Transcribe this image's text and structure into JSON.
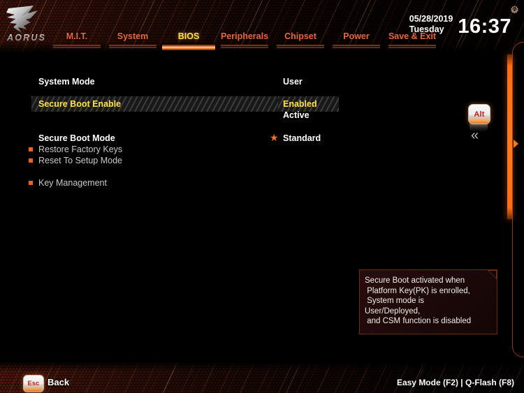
{
  "header": {
    "logo_wordmark": "AORUS",
    "logo_icon": "aorus-eagle-logo",
    "gear_icon": "gear-icon",
    "clock": {
      "date": "05/28/2019",
      "weekday": "Tuesday",
      "time": "16:37"
    },
    "tabs": [
      {
        "label": "M.I.T.",
        "active": false
      },
      {
        "label": "System",
        "active": false
      },
      {
        "label": "BIOS",
        "active": true
      },
      {
        "label": "Peripherals",
        "active": false
      },
      {
        "label": "Chipset",
        "active": false
      },
      {
        "label": "Power",
        "active": false
      },
      {
        "label": "Save & Exit",
        "active": false
      }
    ]
  },
  "main": {
    "rows": [
      {
        "label": "System Mode",
        "value": "User",
        "style": "white",
        "bullet": false,
        "star": false,
        "selected": false
      },
      {
        "label": "Secure Boot Enable",
        "value": "Enabled",
        "style": "yellow",
        "bullet": false,
        "star": false,
        "selected": true
      },
      {
        "label": "",
        "value": "Active",
        "style": "white",
        "bullet": false,
        "star": false,
        "selected": false
      },
      {
        "label": "Secure Boot Mode",
        "value": "Standard",
        "style": "white",
        "bullet": false,
        "star": true,
        "selected": false
      },
      {
        "label": "Restore Factory Keys",
        "value": "",
        "style": "grey",
        "bullet": true,
        "star": false,
        "selected": false
      },
      {
        "label": "Reset To Setup Mode",
        "value": "",
        "style": "grey",
        "bullet": true,
        "star": false,
        "selected": false
      },
      {
        "label": "Key Management",
        "value": "",
        "style": "grey",
        "bullet": true,
        "star": false,
        "selected": false
      }
    ]
  },
  "side_panel": {
    "alt_key_label": "Alt",
    "collapse_icon": "double-chevron-left-icon",
    "collapse_glyph": "«",
    "rail_arrow_icon": "expand-panel-arrow-icon"
  },
  "tooltip": {
    "lines": [
      "Secure Boot activated when",
      " Platform Key(PK) is enrolled,",
      " System mode is",
      "User/Deployed,",
      " and CSM function is disabled"
    ]
  },
  "footer": {
    "esc_key_label": "Esc",
    "back_label": "Back",
    "shortcuts": "Easy Mode (F2)  |  Q-Flash (F8)"
  },
  "colors": {
    "accent_orange": "#ff7a1c",
    "tab_orange": "#e8673a",
    "active_yellow": "#ffe14d",
    "bullet_orange": "#f2601c",
    "background": "#000000"
  }
}
